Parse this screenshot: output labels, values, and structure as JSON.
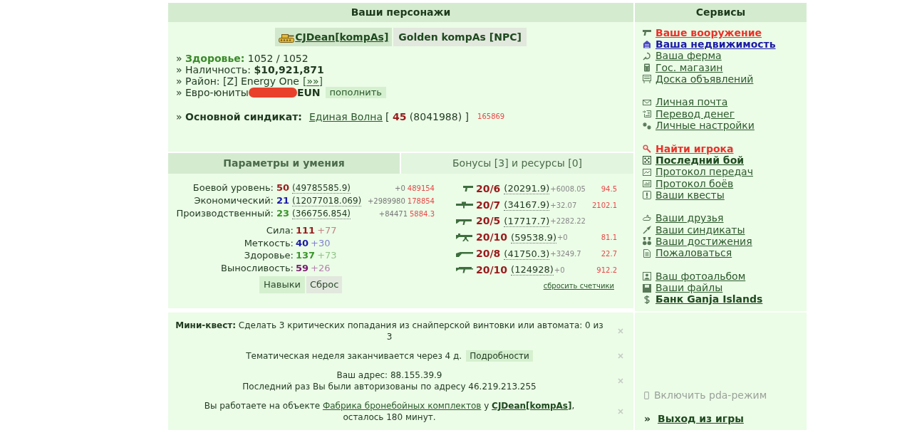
{
  "characters": {
    "title": "Ваши персонажи",
    "tabs": [
      {
        "label": "CJDean[kompAs]",
        "kind": "player"
      },
      {
        "label": "Golden kompAs [NPC]",
        "kind": "npc"
      }
    ],
    "info": [
      {
        "kind": "health",
        "text": "» **Здоровье:** 1052 / 1052"
      },
      {
        "kind": "text",
        "text": "» Наличность: **$10,921,871**"
      },
      {
        "kind": "link",
        "text": "» Район: [Z] Energy One",
        "link": "[»»]"
      },
      {
        "kind": "currency",
        "text": "» Евро-юниты",
        "redacted": true,
        "unit": "EUN",
        "button": "пополнить"
      },
      {
        "kind": "syndicate",
        "text": "» **Основной синдикат:**",
        "link": "Единая Волна",
        "rank": "[ **45** (8041988) ]",
        "extra": "165869"
      }
    ]
  },
  "params": {
    "tabs": [
      {
        "label": "Параметры и умения",
        "selected": true
      },
      {
        "label": "Бонусы [3] и ресурсы [0]",
        "selected": false
      }
    ],
    "stats": [
      {
        "label": "Боевой уровень:",
        "value": "50",
        "exp": "(49785585.9)",
        "gain": "+0",
        "extra": "489154",
        "color": "#981b1b"
      },
      {
        "label": "Экономический:",
        "value": "21",
        "exp": "(12077018.069)",
        "gain": "+2989980",
        "extra": "178854",
        "color": "#1a1aa8"
      },
      {
        "label": "Производственный:",
        "value": "23",
        "exp": "(366756.854)",
        "gain": "+84471",
        "extra": "5884.3",
        "color": "#3a952a"
      }
    ],
    "attributes": [
      {
        "label": "Сила:",
        "value": "111",
        "bonus": "+77",
        "color": "#981b1b"
      },
      {
        "label": "Меткость:",
        "value": "40",
        "bonus": "+30",
        "color": "#1a1aa8"
      },
      {
        "label": "Здоровье:",
        "value": "137",
        "bonus": "+73",
        "color": "#3a952a"
      },
      {
        "label": "Выносливость:",
        "value": "59",
        "bonus": "+26",
        "color": "#7a1a6e"
      }
    ],
    "buttons": [
      {
        "label": "Навыки",
        "kind": "primary"
      },
      {
        "label": "Сброс",
        "kind": "secondary"
      }
    ],
    "weapons": [
      {
        "grade": "20/6",
        "exp": "(20291.9)",
        "gain": "+6008.05",
        "extra": "94.5"
      },
      {
        "grade": "20/7",
        "exp": "(34167.9)",
        "gain": "+32.07",
        "extra": "2102.1"
      },
      {
        "grade": "20/5",
        "exp": "(17717.7)",
        "gain": "+2282.22"
      },
      {
        "grade": "20/10",
        "exp": "(59538.9)",
        "gain": "+0",
        "extra": "81.1"
      },
      {
        "grade": "20/8",
        "exp": "(41750.3)",
        "gain": "+3249.7",
        "extra": "22.7"
      },
      {
        "grade": "20/10",
        "exp": "(124928)",
        "gain": "+0",
        "extra": "912.2"
      }
    ],
    "reset_link": "сбросить счетчики"
  },
  "notices": [
    {
      "kind": "quest",
      "text": "**Мини-квест:** Сделать 3 критических попадания из снайперской винтовки или автомата: 0 из 3"
    },
    {
      "kind": "event",
      "text": "Тематическая неделя заканчивается через 4 д.",
      "button": "Подробности"
    },
    {
      "kind": "address",
      "lines": [
        "Ваш адрес: 88.155.39.9",
        "Последний раз Вы были авторизованы по адресу 46.219.213.255"
      ]
    },
    {
      "kind": "work",
      "text": "Вы работаете на объекте",
      "object": "Фабрика бронебойных комплектов",
      "conj": "у",
      "owner": "CJDean[kompAs]",
      "suffix": ",",
      "tail": "осталось 180 минут."
    }
  ],
  "services": {
    "title": "Сервисы",
    "groups": [
      {
        "items": [
          {
            "label": "Ваше вооружение",
            "kind": "alert"
          },
          {
            "label": "Ваша недвижимость",
            "kind": "info"
          },
          {
            "label": "Ваша ферма",
            "kind": "plain"
          },
          {
            "label": "Гос. магазин",
            "kind": "plain"
          },
          {
            "label": "Доска объявлений",
            "kind": "plain"
          }
        ]
      },
      {
        "items": [
          {
            "label": "Личная почта",
            "kind": "plain"
          },
          {
            "label": "Перевод денег",
            "kind": "plain"
          },
          {
            "label": "Личные настройки",
            "kind": "plain"
          }
        ]
      },
      {
        "items": [
          {
            "label": "Найти игрока",
            "kind": "alert"
          },
          {
            "label": "Последний бой",
            "kind": "strong"
          },
          {
            "label": "Протокол передач",
            "kind": "plain"
          },
          {
            "label": "Протокол боёв",
            "kind": "plain"
          },
          {
            "label": "Ваши квесты",
            "kind": "plain"
          }
        ]
      },
      {
        "items": [
          {
            "label": "Ваши друзья",
            "kind": "plain"
          },
          {
            "label": "Ваши синдикаты",
            "kind": "plain"
          },
          {
            "label": "Ваши достижения",
            "kind": "plain"
          },
          {
            "label": "Пожаловаться",
            "kind": "plain"
          }
        ]
      },
      {
        "items": [
          {
            "label": "Ваш фотоальбом",
            "kind": "plain"
          },
          {
            "label": "Ваши файлы",
            "kind": "plain"
          },
          {
            "label": "Банк Ganja Islands",
            "kind": "strong"
          }
        ]
      }
    ],
    "pda": "Включить pda-режим",
    "exit": {
      "bullet": "»",
      "label": "Выход из игры"
    }
  }
}
